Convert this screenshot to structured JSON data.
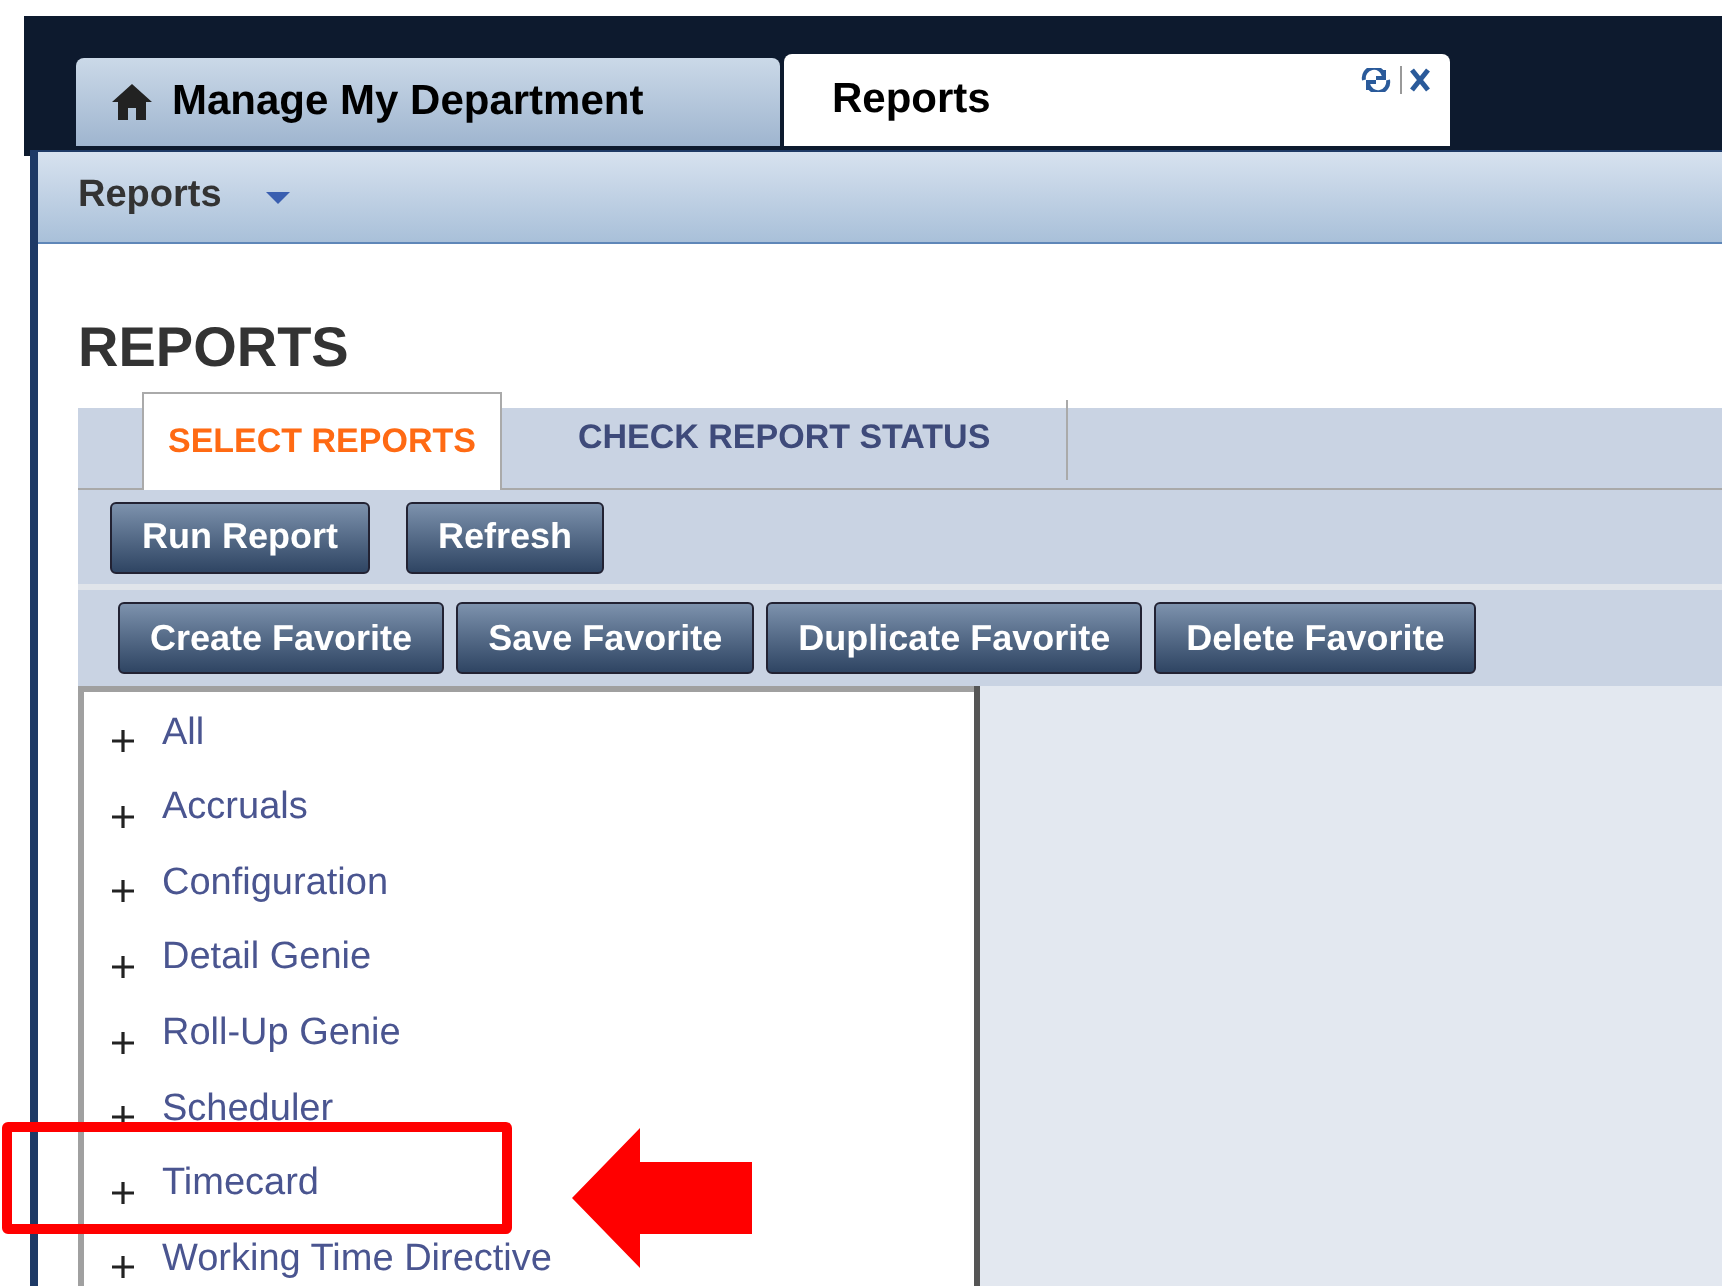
{
  "app_tabs": [
    {
      "label": "Manage My Department",
      "selected": false
    },
    {
      "label": "Reports",
      "selected": true
    }
  ],
  "menu": {
    "label": "Reports"
  },
  "heading": "REPORTS",
  "report_tabs": [
    {
      "label": "SELECT REPORTS",
      "selected": true
    },
    {
      "label": "CHECK REPORT STATUS",
      "selected": false
    }
  ],
  "action_buttons": [
    "Run Report",
    "Refresh"
  ],
  "favorite_buttons": [
    "Create Favorite",
    "Save Favorite",
    "Duplicate Favorite",
    "Delete Favorite"
  ],
  "tree": [
    {
      "label": "All",
      "expanded": false
    },
    {
      "label": "Accruals",
      "expanded": false
    },
    {
      "label": "Configuration",
      "expanded": false
    },
    {
      "label": "Detail Genie",
      "expanded": false
    },
    {
      "label": "Roll-Up Genie",
      "expanded": false
    },
    {
      "label": "Scheduler",
      "expanded": false
    },
    {
      "label": "Timecard",
      "expanded": false,
      "highlighted": true
    },
    {
      "label": "Working Time Directive",
      "expanded": false
    }
  ]
}
